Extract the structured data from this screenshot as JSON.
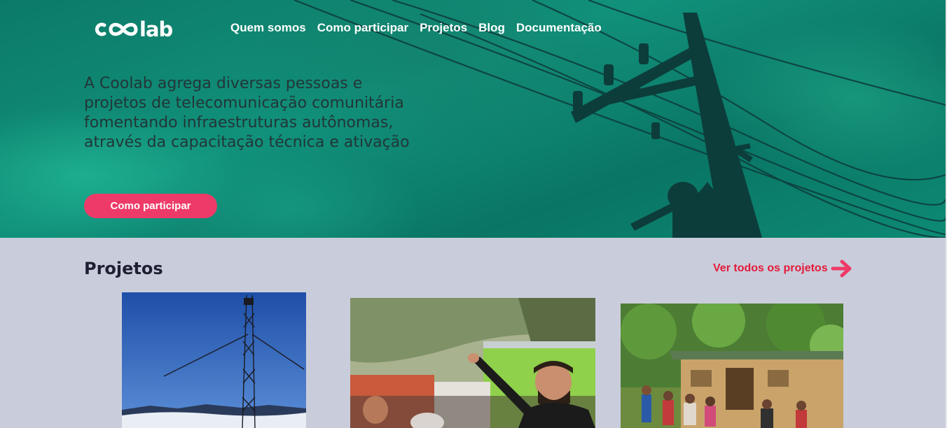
{
  "header": {
    "logo_text": "lab",
    "logo_alt": "coolab",
    "nav": [
      {
        "label": "Quem somos"
      },
      {
        "label": "Como participar"
      },
      {
        "label": "Projetos"
      },
      {
        "label": "Blog"
      },
      {
        "label": "Documentação"
      }
    ]
  },
  "hero": {
    "tagline_lines": [
      "A Coolab agrega diversas pessoas e",
      "projetos de telecomunicação comunitária",
      "fomentando infraestruturas autônomas,",
      "através da capacitação técnica e ativação"
    ],
    "cta_label": "Como participar"
  },
  "projects": {
    "title": "Projetos",
    "see_all_label": "Ver todos os projetos",
    "see_all_icon": "arrow-right-icon",
    "cards": [
      {
        "image": "antenna-tower-photo"
      },
      {
        "image": "community-meeting-photo"
      },
      {
        "image": "wooden-house-photo"
      }
    ]
  },
  "colors": {
    "accent": "#ee3a68",
    "link": "#e41a3a",
    "hero_teal": "#0f8a74",
    "section_bg": "#c9cddb",
    "heading": "#1f1f33"
  }
}
